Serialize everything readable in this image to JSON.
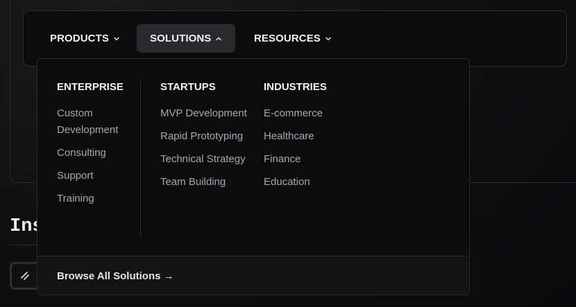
{
  "nav": {
    "items": [
      {
        "label": "PRODUCTS",
        "icon": "chevron-down-icon",
        "active": false
      },
      {
        "label": "SOLUTIONS",
        "icon": "chevron-up-icon",
        "active": true
      },
      {
        "label": "RESOURCES",
        "icon": "chevron-down-icon",
        "active": false
      }
    ]
  },
  "background": {
    "heading_fragment": "Ins"
  },
  "dropdown": {
    "columns": [
      {
        "title": "ENTERPRISE",
        "items": [
          "Custom Development",
          "Consulting",
          "Support",
          "Training"
        ]
      },
      {
        "title": "STARTUPS",
        "items": [
          "MVP Development",
          "Rapid Prototyping",
          "Technical Strategy",
          "Team Building"
        ]
      },
      {
        "title": "INDUSTRIES",
        "items": [
          "E-commerce",
          "Healthcare",
          "Finance",
          "Education"
        ]
      }
    ],
    "footer_link": "Browse All Solutions →"
  },
  "colors": {
    "background": "#0b0b0c",
    "panel": "#0c0c0d",
    "active_nav_bg": "#2a2a2c",
    "border": "#2c2c2f",
    "muted_text": "#a9a9ad"
  }
}
